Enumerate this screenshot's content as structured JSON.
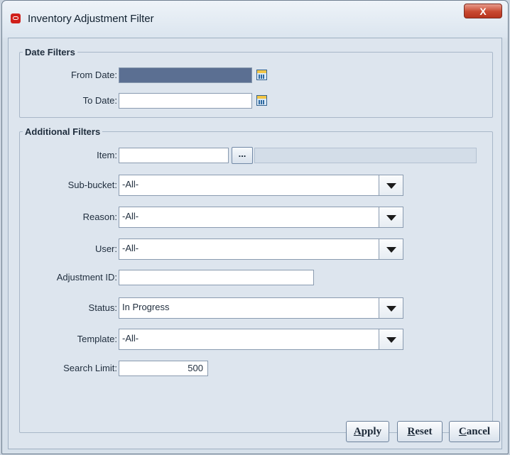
{
  "window": {
    "title": "Inventory Adjustment Filter",
    "close_label": "X"
  },
  "date_filters": {
    "legend": "Date Filters",
    "from_date": {
      "label": "From Date:",
      "value": ""
    },
    "to_date": {
      "label": "To Date:",
      "value": ""
    }
  },
  "additional_filters": {
    "legend": "Additional Filters",
    "item": {
      "label": "Item:",
      "value": "",
      "button_label": "..."
    },
    "sub_bucket": {
      "label": "Sub-bucket:",
      "value": "-All-"
    },
    "reason": {
      "label": "Reason:",
      "value": "-All-"
    },
    "user": {
      "label": "User:",
      "value": "-All-"
    },
    "adjustment_id": {
      "label": "Adjustment ID:",
      "value": ""
    },
    "status": {
      "label": "Status:",
      "value": "In Progress"
    },
    "template": {
      "label": "Template:",
      "value": "-All-"
    },
    "search_limit": {
      "label": "Search Limit:",
      "value": "500"
    }
  },
  "buttons": {
    "apply": {
      "mnemonic": "A",
      "rest": "pply"
    },
    "reset": {
      "mnemonic": "R",
      "rest": "eset"
    },
    "cancel": {
      "mnemonic": "C",
      "rest": "ancel"
    }
  },
  "icons": {
    "app": "oracle-app-icon",
    "calendar": "calendar-icon",
    "dropdown": "chevron-down-icon"
  }
}
